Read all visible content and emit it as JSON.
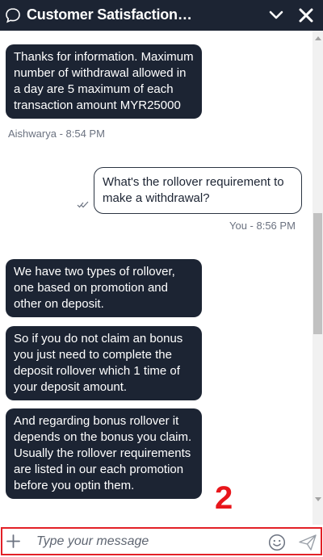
{
  "header": {
    "title": "Customer Satisfaction…"
  },
  "messages": [
    {
      "sender": "agent",
      "text": "Thanks for information. Maximum number of withdrawal allowed in a day are 5 maximum of each transaction amount MYR25000"
    },
    {
      "meta": "Aishwarya - 8:54 PM"
    },
    {
      "sender": "user",
      "text": "What's the rollover requirement to make a withdrawal?"
    },
    {
      "meta": "You - 8:56 PM"
    },
    {
      "sender": "agent",
      "text": "We have two types of rollover, one based on promotion and other on deposit."
    },
    {
      "sender": "agent",
      "text": "So if you do not claim an bonus you just need to complete the deposit rollover which 1 time of your deposit amount."
    },
    {
      "sender": "agent",
      "text": "And regarding bonus rollover it depends on the bonus you claim. Usually the rollover requirements are listed in our each promotion before you optin them."
    }
  ],
  "annotation": {
    "label": "2"
  },
  "composer": {
    "placeholder": "Type your message"
  },
  "colors": {
    "header_bg": "#1c2433",
    "agent_bubble": "#1c2433",
    "annotation_red": "#e32027"
  },
  "icons": [
    "chat-bubble-icon",
    "chevron-down-icon",
    "close-icon",
    "double-check-icon",
    "plus-icon",
    "emoji-icon",
    "send-icon"
  ]
}
